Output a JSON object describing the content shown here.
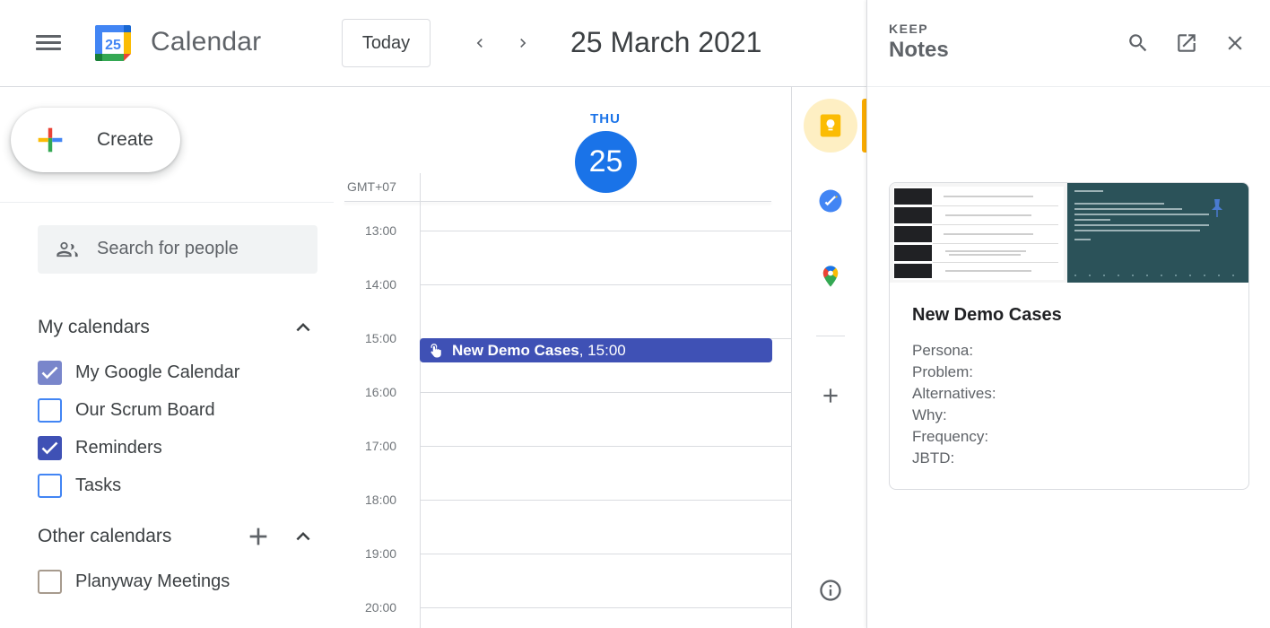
{
  "header": {
    "app_title": "Calendar",
    "logo_day": "25",
    "today_label": "Today",
    "date_title": "25 March 2021"
  },
  "sidebar": {
    "create_label": "Create",
    "search_placeholder": "Search for people",
    "my_calendars_title": "My calendars",
    "my_calendars": [
      {
        "label": "My Google Calendar",
        "checked": true,
        "color": "#7986cb"
      },
      {
        "label": "Our Scrum Board",
        "checked": false,
        "color": "#4285f4"
      },
      {
        "label": "Reminders",
        "checked": true,
        "color": "#3f51b5"
      },
      {
        "label": "Tasks",
        "checked": false,
        "color": "#4285f4"
      }
    ],
    "other_calendars_title": "Other calendars",
    "other_calendars": [
      {
        "label": "Planyway Meetings",
        "checked": false,
        "color": "#a79b8e"
      }
    ]
  },
  "day_view": {
    "day_label": "THU",
    "day_number": "25",
    "timezone": "GMT+07",
    "hours": [
      "13:00",
      "14:00",
      "15:00",
      "16:00",
      "17:00",
      "18:00",
      "19:00",
      "20:00"
    ],
    "event": {
      "title": "New Demo Cases",
      "time": ", 15:00",
      "color": "#3f51b5"
    }
  },
  "keep_panel": {
    "overline": "KEEP",
    "title": "Notes",
    "note": {
      "title": "New Demo Cases",
      "lines": [
        "Persona:",
        "Problem:",
        "Alternatives:",
        "Why:",
        "Frequency:",
        "JBTD:"
      ]
    }
  },
  "icons": {
    "menu": "hamburger-icon",
    "search": "search-icon",
    "open_new": "open-in-new-icon",
    "close": "close-icon",
    "keep": "keep-icon",
    "tasks": "tasks-icon",
    "maps": "maps-icon",
    "add": "plus-icon",
    "info": "info-icon"
  },
  "colors": {
    "accent": "#1a73e8",
    "event": "#3f51b5",
    "keep": "#f9ab00"
  }
}
